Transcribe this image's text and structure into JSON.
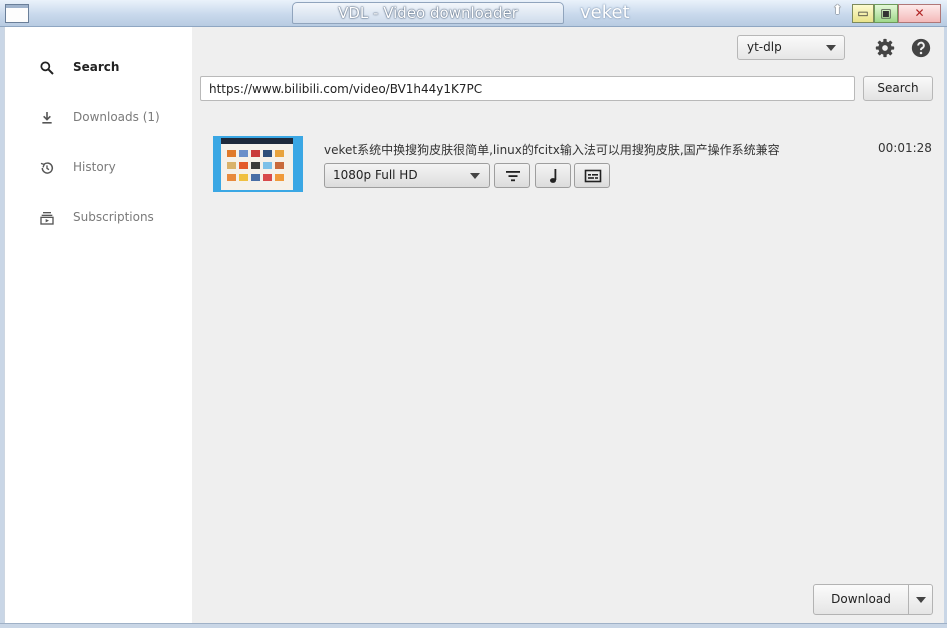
{
  "window": {
    "title": "VDL - Video downloader",
    "user": "veket",
    "controls": {
      "minimize": "▭",
      "maximize": "▣",
      "close": "✕"
    }
  },
  "sidebar": {
    "items": [
      {
        "label": "Search",
        "icon": "search-icon",
        "active": true
      },
      {
        "label": "Downloads (1)",
        "icon": "download-icon",
        "active": false
      },
      {
        "label": "History",
        "icon": "history-icon",
        "active": false
      },
      {
        "label": "Subscriptions",
        "icon": "subscriptions-icon",
        "active": false
      }
    ]
  },
  "toolbar": {
    "engine": "yt-dlp",
    "settings_icon": "gear-icon",
    "help_icon": "help-icon"
  },
  "search": {
    "url": "https://www.bilibili.com/video/BV1h44y1K7PC",
    "button": "Search"
  },
  "result": {
    "title": "veket系统中换搜狗皮肤很简单,linux的fcitx输入法可以用搜狗皮肤,国产操作系统兼容",
    "duration": "00:01:28",
    "quality": "1080p Full HD",
    "buttons": [
      "filter-icon",
      "music-note-icon",
      "subtitles-icon"
    ]
  },
  "footer": {
    "download": "Download"
  },
  "colors": {
    "titlebar": "#c9d9ec",
    "sidebar": "#ffffff",
    "main": "#efefef"
  }
}
